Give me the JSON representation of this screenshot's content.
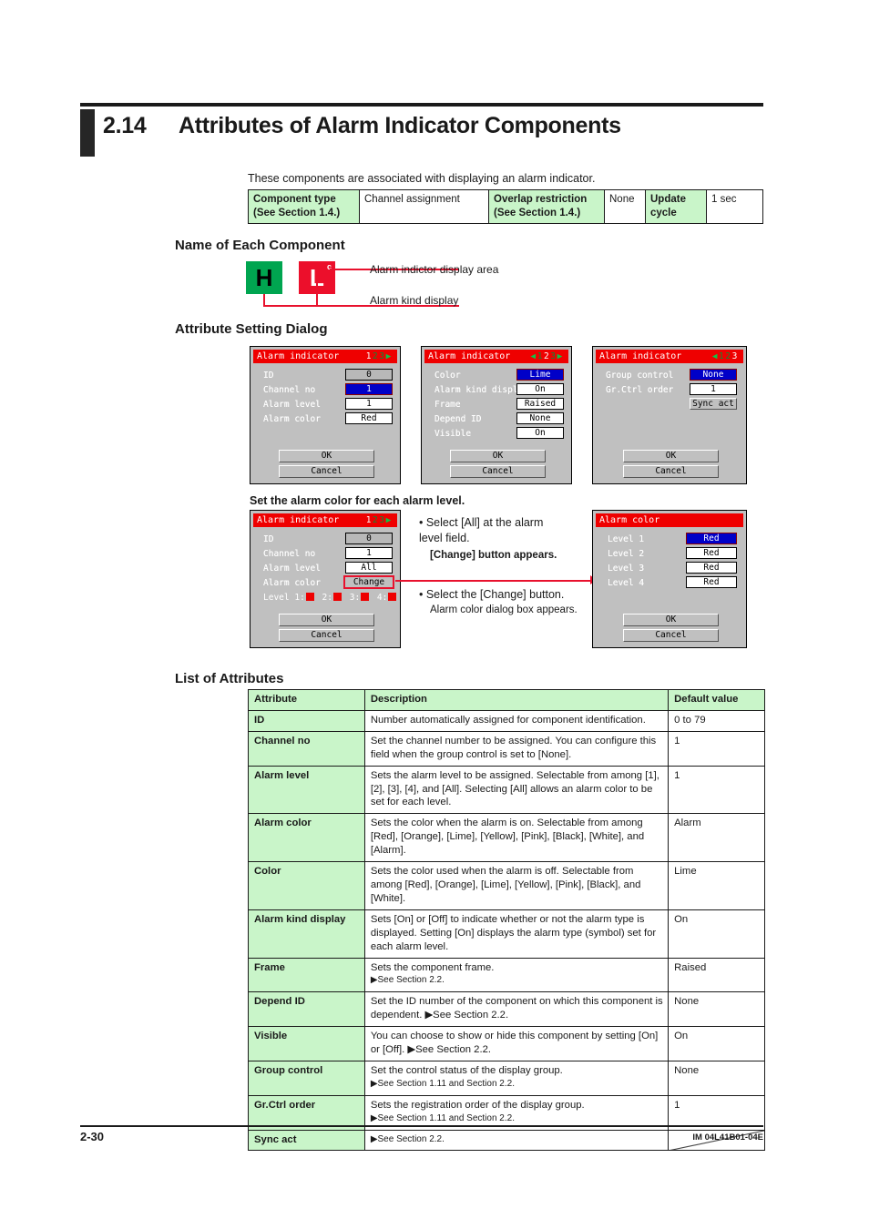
{
  "header": {
    "section_number": "2.14",
    "section_title": "Attributes of Alarm Indicator Components",
    "intro": "These components are associated with displaying an alarm indicator."
  },
  "summary_table": {
    "cells": [
      {
        "label": "Component type",
        "label2": "(See Section 1.4.)",
        "value": "Channel assignment"
      },
      {
        "label": "Overlap restriction",
        "label2": "(See Section 1.4.)",
        "value": "None"
      },
      {
        "label": "Update",
        "label2": "cycle",
        "value": "1 sec"
      }
    ]
  },
  "sections": {
    "name_of_each_component": "Name of Each Component",
    "attribute_setting_dialog": "Attribute Setting Dialog",
    "set_alarm_color": "Set the alarm color for each alarm level.",
    "list_of_attributes": "List of Attributes"
  },
  "component_figure": {
    "green_symbol": "H",
    "red_symbol": "L",
    "red_superscript": "c",
    "callout_top": "Alarm indictor display area",
    "callout_bottom": "Alarm kind display"
  },
  "dialogs": {
    "page1": {
      "title": "Alarm indicator",
      "nav": {
        "arrow_left": "",
        "pages": [
          "1",
          "2",
          "3"
        ],
        "current": "1",
        "arrow_right": "▶"
      },
      "fields": [
        {
          "label": "ID",
          "value": "0",
          "style": "gray"
        },
        {
          "label": "Channel no",
          "value": "1",
          "style": "sel"
        },
        {
          "label": "Alarm level",
          "value": "1",
          "style": "plain"
        },
        {
          "label": "Alarm color",
          "value": "Red",
          "style": "plain"
        }
      ],
      "ok": "OK",
      "cancel": "Cancel"
    },
    "page2": {
      "title": "Alarm indicator",
      "nav": {
        "arrow_left": "◀",
        "pages": [
          "1",
          "2",
          "3"
        ],
        "current": "2",
        "arrow_right": "▶"
      },
      "fields": [
        {
          "label": "Color",
          "value": "Lime",
          "style": "sel"
        },
        {
          "label": "Alarm kind display",
          "value": "On",
          "style": "plain"
        },
        {
          "label": "Frame",
          "value": "Raised",
          "style": "plain"
        },
        {
          "label": "Depend ID",
          "value": "None",
          "style": "plain"
        },
        {
          "label": "Visible",
          "value": "On",
          "style": "plain"
        }
      ],
      "ok": "OK",
      "cancel": "Cancel"
    },
    "page3": {
      "title": "Alarm indicator",
      "nav": {
        "arrow_left": "◀",
        "pages": [
          "1",
          "2",
          "3"
        ],
        "current": "3",
        "arrow_right": ""
      },
      "fields": [
        {
          "label": "Group control",
          "value": "None",
          "style": "sel"
        },
        {
          "label": "Gr.Ctrl order",
          "value": "1",
          "style": "plain"
        }
      ],
      "sync_button": "Sync act",
      "ok": "OK",
      "cancel": "Cancel"
    },
    "page_all": {
      "title": "Alarm indicator",
      "nav": {
        "arrow_left": "",
        "pages": [
          "1",
          "2",
          "3"
        ],
        "current": "1",
        "arrow_right": "▶"
      },
      "fields": [
        {
          "label": "ID",
          "value": "0",
          "style": "gray"
        },
        {
          "label": "Channel no",
          "value": "1",
          "style": "plain"
        },
        {
          "label": "Alarm level",
          "value": "All",
          "style": "plain"
        },
        {
          "label": "Alarm color",
          "value": "Change",
          "style": "btn-hi"
        }
      ],
      "levels_prefix": "Level",
      "levels": [
        "1:",
        "2:",
        "3:",
        "4:"
      ],
      "ok": "OK",
      "cancel": "Cancel"
    },
    "alarm_color": {
      "title": "Alarm color",
      "fields": [
        {
          "label": "Level 1",
          "value": "Red",
          "style": "sel"
        },
        {
          "label": "Level 2",
          "value": "Red",
          "style": "plain"
        },
        {
          "label": "Level 3",
          "value": "Red",
          "style": "plain"
        },
        {
          "label": "Level 4",
          "value": "Red",
          "style": "plain"
        }
      ],
      "ok": "OK",
      "cancel": "Cancel"
    }
  },
  "instructions": [
    {
      "bullet": "• Select [All] at the alarm",
      "line2": "level field.",
      "note": "[Change] button appears."
    },
    {
      "bullet": "• Select the [Change] button.",
      "line2": "",
      "note": "Alarm color dialog box appears."
    }
  ],
  "attributes_table": {
    "columns": [
      "Attribute",
      "Description",
      "Default value"
    ],
    "rows": [
      {
        "attribute": "ID",
        "description": "Number automatically assigned for component identification.",
        "default": "0 to 79"
      },
      {
        "attribute": "Channel no",
        "description": "Set the channel number to be assigned. You can configure this field when the group control is set to [None].",
        "default": "1"
      },
      {
        "attribute": "Alarm level",
        "description": "Sets the alarm level to be assigned. Selectable from among [1], [2], [3], [4], and [All]. Selecting [All] allows an alarm color to be set for each level.",
        "default": "1"
      },
      {
        "attribute": "Alarm color",
        "description": "Sets the color when the alarm is on. Selectable from among [Red], [Orange], [Lime], [Yellow], [Pink], [Black], [White], and [Alarm].",
        "default": "Alarm"
      },
      {
        "attribute": "Color",
        "description": "Sets the color used when the alarm is off. Selectable from among [Red], [Orange], [Lime], [Yellow], [Pink], [Black], and [White].",
        "default": "Lime"
      },
      {
        "attribute": "Alarm kind display",
        "description": "Sets [On] or [Off] to indicate whether or not the alarm type is displayed. Setting [On] displays the alarm type (symbol) set for each alarm level.",
        "default": "On"
      },
      {
        "attribute": "Frame",
        "description": "Sets the component frame.",
        "description2": "▶See Section 2.2.",
        "default": "Raised"
      },
      {
        "attribute": "Depend ID",
        "description": "Set the ID number of the component on which this component is dependent. ▶See Section 2.2.",
        "default": "None"
      },
      {
        "attribute": "Visible",
        "description": "You can choose to show or hide this component by setting [On] or [Off]. ▶See Section 2.2.",
        "default": "On"
      },
      {
        "attribute": "Group control",
        "description": "Set the control status of the display group.",
        "description2": "▶See Section 1.11 and Section 2.2.",
        "default": "None"
      },
      {
        "attribute": "Gr.Ctrl order",
        "description": "Sets the registration order of the display group.",
        "description2": "▶See Section 1.11 and Section 2.2.",
        "default": "1"
      },
      {
        "attribute": "Sync act",
        "description": "▶See Section 2.2.",
        "default": ""
      }
    ]
  },
  "footer": {
    "page_number": "2-30",
    "document_code": "IM 04L41B01-04E"
  }
}
